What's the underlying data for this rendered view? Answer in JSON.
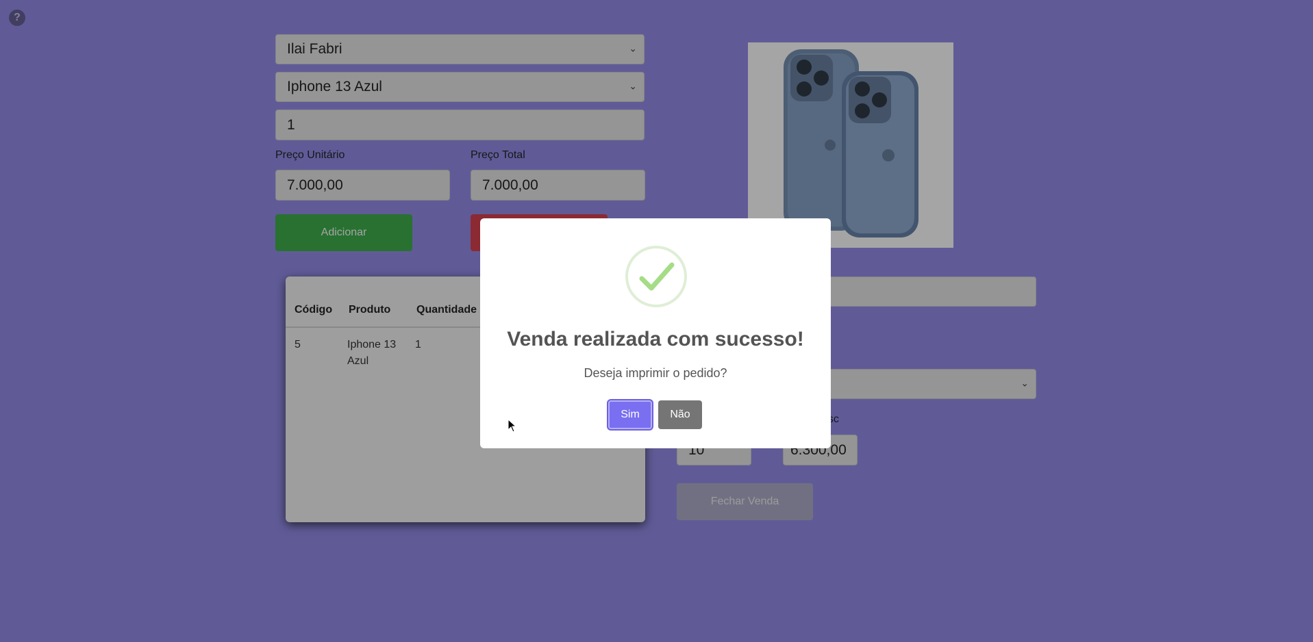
{
  "help": {
    "icon": "question-circle-icon",
    "label": "?"
  },
  "form": {
    "client_select": "Ilai Fabri",
    "product_select": "Iphone 13 Azul",
    "quantity": "1",
    "unit_price_label": "Preço Unitário",
    "unit_price": "7.000,00",
    "total_price_label": "Preço Total",
    "total_price": "7.000,00",
    "add_button": "Adicionar"
  },
  "table": {
    "headers": [
      "Código",
      "Produto",
      "Quantidade"
    ],
    "rows": [
      {
        "codigo": "5",
        "produto": "Iphone 13 Azul",
        "quantidade": "1"
      }
    ]
  },
  "summary": {
    "desc_label_partial": "esc",
    "discount_value": "10",
    "total_with_discount": "6.300,00",
    "close_sale_button": "Fechar Venda"
  },
  "modal": {
    "title": "Venda realizada com sucesso!",
    "text": "Deseja imprimir o pedido?",
    "yes_button": "Sim",
    "no_button": "Não"
  },
  "colors": {
    "background": "#8c84e8",
    "green": "#2fa83f",
    "red": "#d63342",
    "modal_confirm": "#7a6ff0",
    "modal_cancel": "#757575"
  }
}
